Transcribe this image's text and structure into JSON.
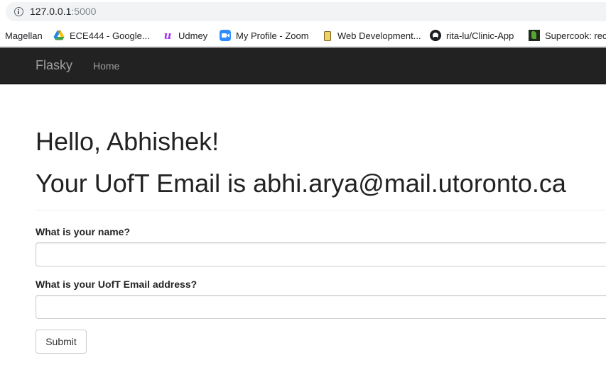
{
  "browser": {
    "url_host": "127.0.0.1",
    "url_port": ":5000"
  },
  "bookmarks": [
    {
      "label": "Magellan",
      "icon": "none"
    },
    {
      "label": "ECE444 - Google...",
      "icon": "google-drive-icon"
    },
    {
      "label": "Udmey",
      "icon": "udemy-icon"
    },
    {
      "label": "My Profile - Zoom",
      "icon": "zoom-icon"
    },
    {
      "label": "Web Development...",
      "icon": "web-dev-icon"
    },
    {
      "label": "rita-lu/Clinic-App",
      "icon": "github-icon"
    },
    {
      "label": "Supercook: rec",
      "icon": "supercook-icon"
    }
  ],
  "navbar": {
    "brand": "Flasky",
    "home_label": "Home"
  },
  "main": {
    "greeting": "Hello, Abhishek!",
    "email_line": "Your UofT Email is abhi.arya@mail.utoronto.ca"
  },
  "form": {
    "name_label": "What is your name?",
    "name_value": "",
    "email_label": "What is your UofT Email address?",
    "email_value": "",
    "submit_label": "Submit"
  },
  "colors": {
    "navbar_bg": "#222222",
    "navbar_text": "#9d9d9d"
  }
}
